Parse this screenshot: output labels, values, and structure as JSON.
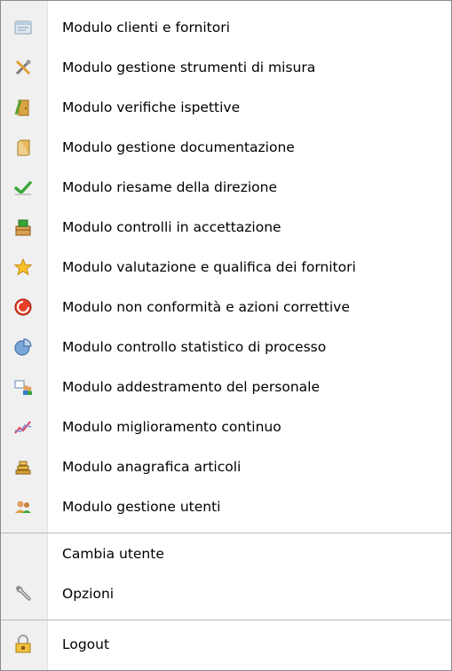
{
  "menu": {
    "items": [
      {
        "label": "Modulo clienti e fornitori",
        "icon": "address-book-icon"
      },
      {
        "label": "Modulo gestione strumenti di misura",
        "icon": "tools-icon"
      },
      {
        "label": "Modulo verifiche ispettive",
        "icon": "door-icon"
      },
      {
        "label": "Modulo gestione documentazione",
        "icon": "binder-icon"
      },
      {
        "label": "Modulo riesame della direzione",
        "icon": "checkmark-icon"
      },
      {
        "label": "Modulo controlli in accettazione",
        "icon": "package-icon"
      },
      {
        "label": "Modulo valutazione e qualifica dei fornitori",
        "icon": "star-icon"
      },
      {
        "label": "Modulo non conformità e azioni correttive",
        "icon": "stop-icon"
      },
      {
        "label": "Modulo controllo statistico di processo",
        "icon": "pie-chart-icon"
      },
      {
        "label": "Modulo addestramento del personale",
        "icon": "training-icon"
      },
      {
        "label": "Modulo miglioramento continuo",
        "icon": "trend-chart-icon"
      },
      {
        "label": "Modulo anagrafica articoli",
        "icon": "stack-icon"
      },
      {
        "label": "Modulo gestione utenti",
        "icon": "users-icon"
      }
    ],
    "change_user_label": "Cambia utente",
    "options_label": "Opzioni",
    "options_icon": "wrench-icon",
    "logout_label": "Logout",
    "logout_icon": "lock-icon"
  }
}
